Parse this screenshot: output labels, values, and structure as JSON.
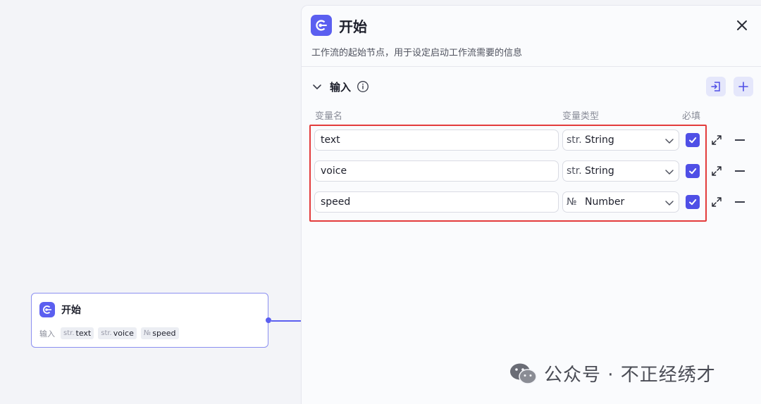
{
  "node": {
    "title": "开始",
    "inputs_label": "输入",
    "tags": [
      {
        "type_glyph": "str.",
        "name": "text"
      },
      {
        "type_glyph": "str.",
        "name": "voice"
      },
      {
        "type_glyph": "№",
        "name": "speed"
      }
    ]
  },
  "panel": {
    "title": "开始",
    "description": "工作流的起始节点，用于设定启动工作流需要的信息",
    "section": {
      "title": "输入",
      "columns": {
        "name": "变量名",
        "type": "变量类型",
        "required": "必填"
      },
      "rows": [
        {
          "name": "text",
          "type_glyph": "str.",
          "type": "String",
          "required": true
        },
        {
          "name": "voice",
          "type_glyph": "str.",
          "type": "String",
          "required": true
        },
        {
          "name": "speed",
          "type_glyph": "№",
          "type": "Number",
          "required": true
        }
      ]
    }
  },
  "watermark": {
    "text": "公众号 · 不正经绣才"
  },
  "colors": {
    "accent": "#5b5ff0",
    "highlight": "#e33b3b",
    "checkbox": "#4f4fe6"
  },
  "icons": [
    "start-node-icon",
    "close-icon",
    "chevron-down-icon",
    "info-icon",
    "import-icon",
    "plus-icon",
    "check-icon",
    "expand-icon",
    "minus-icon",
    "wechat-icon"
  ]
}
